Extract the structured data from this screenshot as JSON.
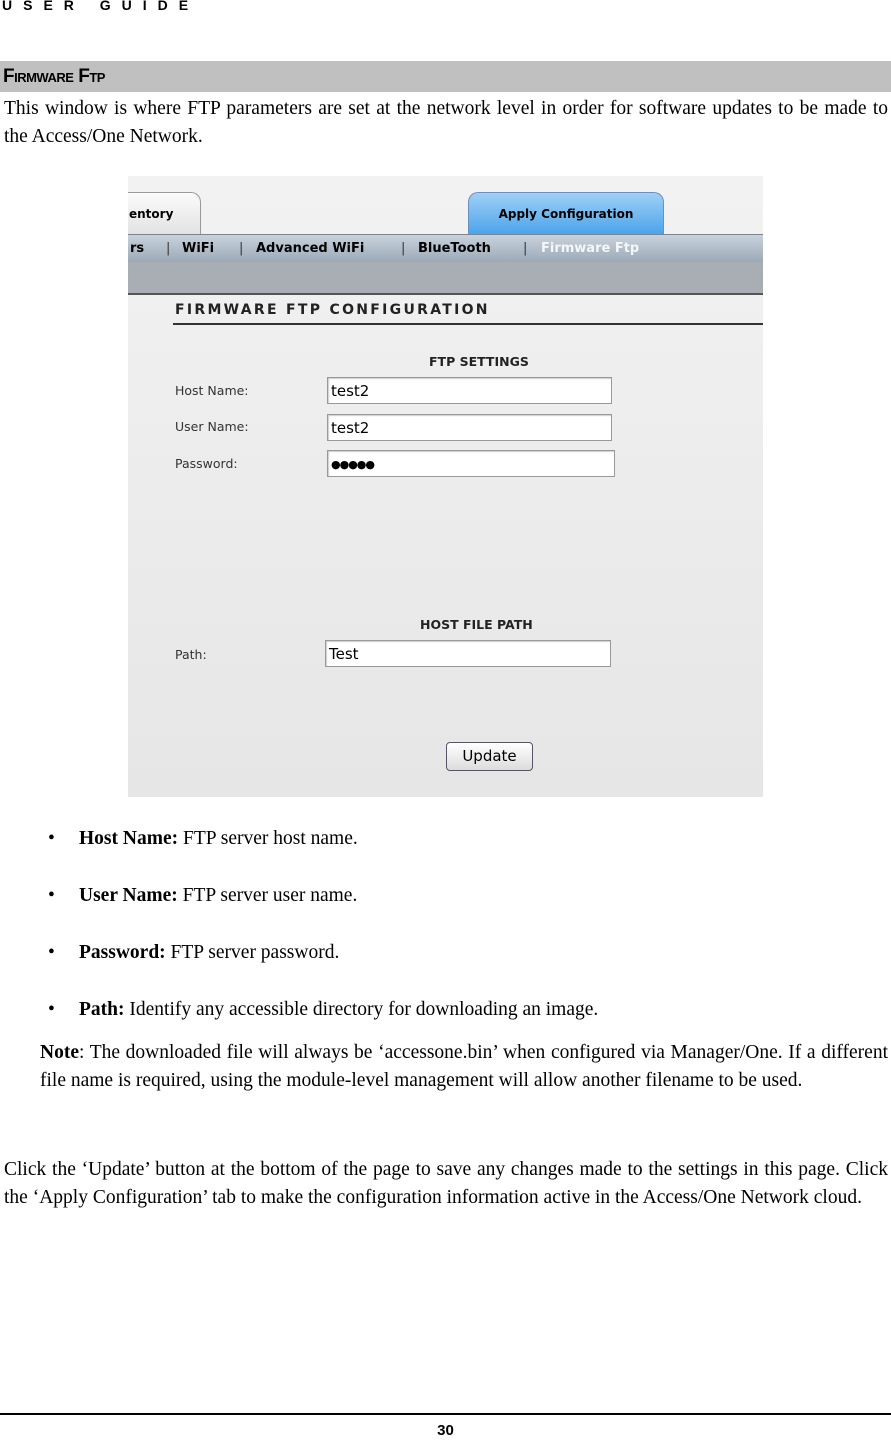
{
  "header": "USER GUIDE",
  "section_title": "Firmware Ftp",
  "intro": "This window is where FTP parameters are set at the network level in order for software updates to be made to the Access/One Network.",
  "screenshot": {
    "tabs": {
      "inventory": "entory",
      "apply": "Apply Configuration"
    },
    "nav": [
      "rs",
      "WiFi",
      "Advanced WiFi",
      "BlueTooth",
      "Firmware Ftp"
    ],
    "title": "FIRMWARE FTP CONFIGURATION",
    "ftp_settings": "FTP SETTINGS",
    "host_label": "Host Name:",
    "host_value": "test2",
    "user_label": "User Name:",
    "user_value": "test2",
    "password_label": "Password:",
    "password_value": "●●●●●",
    "host_file_path": "HOST FILE PATH",
    "path_label": "Path:",
    "path_value": "Test",
    "update": "Update"
  },
  "bullets": [
    {
      "term": "Host Name:",
      "desc": " FTP server host name."
    },
    {
      "term": "User Name:",
      "desc": " FTP server user name."
    },
    {
      "term": "Password:",
      "desc": " FTP server password."
    },
    {
      "term": "Path:",
      "desc": " Identify any accessible directory for downloading an image."
    }
  ],
  "note_label": "Note",
  "note": ": The downloaded file will always be ‘accessone.bin’ when configured via Manager/One. If a different file name is required, using the module-level management will allow another filename to be used.",
  "closing": "Click the ‘Update’ button at the bottom of the page to save any changes made to the settings in this page. Click the ‘Apply Configuration’ tab to make the configuration information active in the Access/One Network cloud.",
  "page_number": "30"
}
